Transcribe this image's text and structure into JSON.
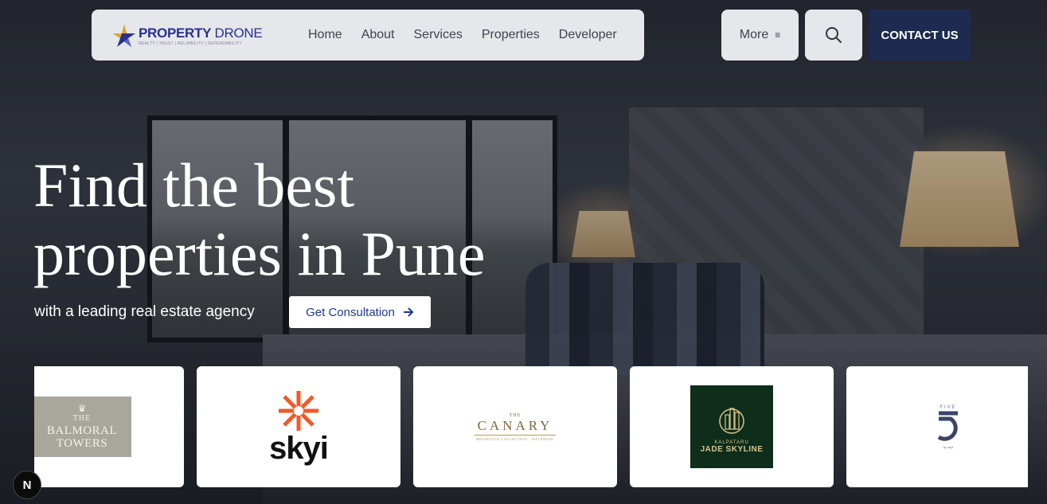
{
  "brand": {
    "name_bold": "PROPERTY",
    "name_light": " DRONE",
    "tagline": "REALTY | TRUST | RELIABILITY | DEPENDABILITY"
  },
  "nav": {
    "links": [
      "Home",
      "About",
      "Services",
      "Properties",
      "Developer"
    ],
    "more_label": "More",
    "more_icon": "≡",
    "contact_label": "CONTACT US"
  },
  "hero": {
    "title_line1": "Find the best",
    "title_line2": "properties in Pune",
    "subtitle": "with a leading real estate agency",
    "cta_label": "Get Consultation"
  },
  "partners": {
    "balmoral": {
      "line1": "THE",
      "line2": "BALMORAL",
      "line3": "TOWERS"
    },
    "skyi": {
      "word": "skyi"
    },
    "canary": {
      "the": "THE",
      "name": "CANARY",
      "sub": "RESIDENCE COLLECTION · BALEWADI"
    },
    "jade": {
      "brand": "KALPATARU",
      "name": "JADE SKYLINE"
    },
    "five": {
      "label": "FIVE",
      "digit": "5",
      "by": "by skyi"
    }
  },
  "dev_badge": "N",
  "colors": {
    "nav_bg": "#e5e7eb",
    "contact_bg": "#1c2b4f",
    "cta_text": "#1c3b8f",
    "skyi_orange": "#f05a28",
    "jade_green": "#0e2d1b"
  }
}
